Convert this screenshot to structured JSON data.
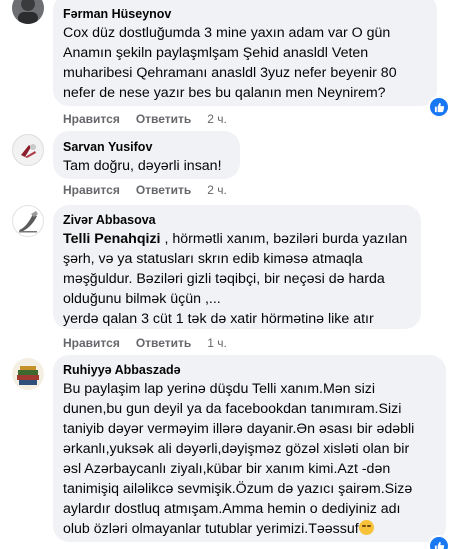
{
  "comments": [
    {
      "author": "Fərman Hüseynov",
      "lines": [
        "Cox düz dostluğumda 3 mine yaxın adam var O gün",
        "Anamın şekiln paylaşmlşam Şehid anasldl Veten",
        "muharibesi Qehramanı anasldl 3yuz nefer beyenir 80",
        "nefer de nese yazır bes bu qalanın men Neynirem?"
      ],
      "like_label": "Нравится",
      "reply_label": "Ответить",
      "time": "2 ч."
    },
    {
      "author": "Sarvan Yusifov",
      "lines": [
        "Tam doğru, dəyərli insan!"
      ],
      "like_label": "Нравится",
      "reply_label": "Ответить",
      "time": "2 ч."
    },
    {
      "author": "Zivər Abbasova",
      "mention": "Telli Penahqizi",
      "lines": [
        ", hörmətli xanım, bəziləri burda yazılan",
        "şərh, və ya statusları skrın edib kiməsə atmaqla",
        "məşğuldur. Bəziləri gizli təqibçi, bir neçəsi də harda",
        "olduğunu bilmək üçün ,...",
        "yerdə qalan 3 cüt 1 tək də xatir hörmətinə like atır"
      ],
      "like_label": "Нравится",
      "reply_label": "Ответить",
      "time": "1 ч."
    },
    {
      "author": "Ruhiyyə Abbaszadə",
      "lines": [
        "Bu paylaşim lap yerinə düşdu Telli xanım.Mən sizi",
        "dunen,bu gun deyil ya da facebookdan tanımıram.Sizi",
        "taniyib dəyər verməyim illərə dayanir.Ən əsası bir ədəbli",
        "ərkanlı,yuksək ali dəyərli,dəyişməz gözəl xisləti olan bir",
        "əsl Azərbaycanlı ziyalı,kübar bir xanım kimi.Azt -dən",
        "tanimişiq ailəlikcə sevmişik.Özum də yazıcı şairəm.Sizə",
        "aylardır dostluq atmışam.Amma hemin o dediyiniz adı",
        "olub özləri olmayanlar tutublar yerimizi.Təəssuf"
      ],
      "like_label": "Нравится",
      "reply_label": "Ответить",
      "time": "2 ч."
    }
  ],
  "icons": {
    "like_badge": "thumbs-up-icon",
    "emoji": "sad-face-emoji-icon"
  },
  "colors": {
    "bubble": "#f0f2f5",
    "meta": "#65676b",
    "like_blue": "#1877f2"
  }
}
